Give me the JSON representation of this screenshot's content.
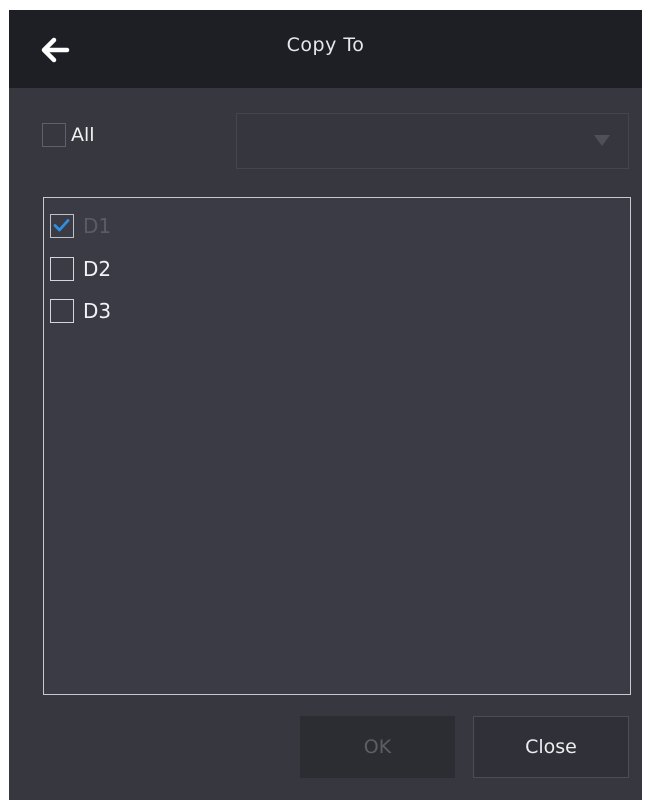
{
  "dialog": {
    "title": "Copy To",
    "back_icon": "arrow-left-icon"
  },
  "select_all": {
    "label": "All",
    "checked": false,
    "disabled": true
  },
  "target_dropdown": {
    "value": "",
    "disabled": true,
    "icon": "triangle-down-icon"
  },
  "devices": [
    {
      "label": "D1",
      "checked": true,
      "disabled": true
    },
    {
      "label": "D2",
      "checked": false,
      "disabled": false
    },
    {
      "label": "D3",
      "checked": false,
      "disabled": false
    }
  ],
  "buttons": {
    "ok_label": "OK",
    "ok_disabled": true,
    "close_label": "Close"
  },
  "colors": {
    "header_bg": "#1e1f25",
    "body_bg": "#36373f",
    "checkmark": "#2f8fe0"
  }
}
